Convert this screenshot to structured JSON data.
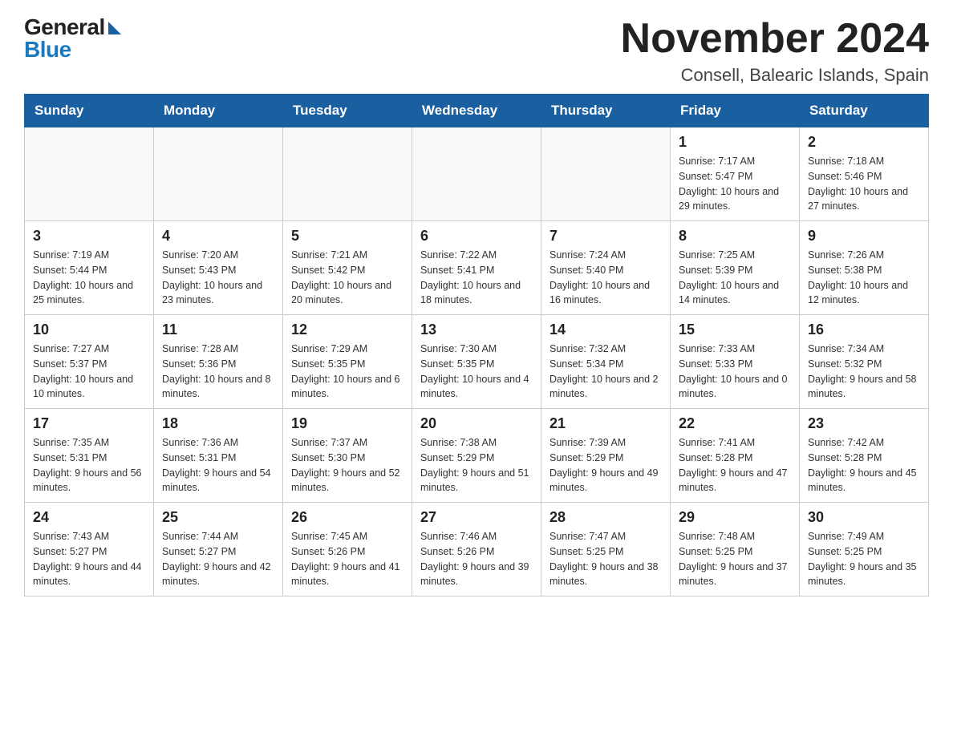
{
  "header": {
    "logo_general": "General",
    "logo_blue": "Blue",
    "title": "November 2024",
    "subtitle": "Consell, Balearic Islands, Spain"
  },
  "days_of_week": [
    "Sunday",
    "Monday",
    "Tuesday",
    "Wednesday",
    "Thursday",
    "Friday",
    "Saturday"
  ],
  "weeks": [
    [
      {
        "day": "",
        "info": ""
      },
      {
        "day": "",
        "info": ""
      },
      {
        "day": "",
        "info": ""
      },
      {
        "day": "",
        "info": ""
      },
      {
        "day": "",
        "info": ""
      },
      {
        "day": "1",
        "info": "Sunrise: 7:17 AM\nSunset: 5:47 PM\nDaylight: 10 hours and 29 minutes."
      },
      {
        "day": "2",
        "info": "Sunrise: 7:18 AM\nSunset: 5:46 PM\nDaylight: 10 hours and 27 minutes."
      }
    ],
    [
      {
        "day": "3",
        "info": "Sunrise: 7:19 AM\nSunset: 5:44 PM\nDaylight: 10 hours and 25 minutes."
      },
      {
        "day": "4",
        "info": "Sunrise: 7:20 AM\nSunset: 5:43 PM\nDaylight: 10 hours and 23 minutes."
      },
      {
        "day": "5",
        "info": "Sunrise: 7:21 AM\nSunset: 5:42 PM\nDaylight: 10 hours and 20 minutes."
      },
      {
        "day": "6",
        "info": "Sunrise: 7:22 AM\nSunset: 5:41 PM\nDaylight: 10 hours and 18 minutes."
      },
      {
        "day": "7",
        "info": "Sunrise: 7:24 AM\nSunset: 5:40 PM\nDaylight: 10 hours and 16 minutes."
      },
      {
        "day": "8",
        "info": "Sunrise: 7:25 AM\nSunset: 5:39 PM\nDaylight: 10 hours and 14 minutes."
      },
      {
        "day": "9",
        "info": "Sunrise: 7:26 AM\nSunset: 5:38 PM\nDaylight: 10 hours and 12 minutes."
      }
    ],
    [
      {
        "day": "10",
        "info": "Sunrise: 7:27 AM\nSunset: 5:37 PM\nDaylight: 10 hours and 10 minutes."
      },
      {
        "day": "11",
        "info": "Sunrise: 7:28 AM\nSunset: 5:36 PM\nDaylight: 10 hours and 8 minutes."
      },
      {
        "day": "12",
        "info": "Sunrise: 7:29 AM\nSunset: 5:35 PM\nDaylight: 10 hours and 6 minutes."
      },
      {
        "day": "13",
        "info": "Sunrise: 7:30 AM\nSunset: 5:35 PM\nDaylight: 10 hours and 4 minutes."
      },
      {
        "day": "14",
        "info": "Sunrise: 7:32 AM\nSunset: 5:34 PM\nDaylight: 10 hours and 2 minutes."
      },
      {
        "day": "15",
        "info": "Sunrise: 7:33 AM\nSunset: 5:33 PM\nDaylight: 10 hours and 0 minutes."
      },
      {
        "day": "16",
        "info": "Sunrise: 7:34 AM\nSunset: 5:32 PM\nDaylight: 9 hours and 58 minutes."
      }
    ],
    [
      {
        "day": "17",
        "info": "Sunrise: 7:35 AM\nSunset: 5:31 PM\nDaylight: 9 hours and 56 minutes."
      },
      {
        "day": "18",
        "info": "Sunrise: 7:36 AM\nSunset: 5:31 PM\nDaylight: 9 hours and 54 minutes."
      },
      {
        "day": "19",
        "info": "Sunrise: 7:37 AM\nSunset: 5:30 PM\nDaylight: 9 hours and 52 minutes."
      },
      {
        "day": "20",
        "info": "Sunrise: 7:38 AM\nSunset: 5:29 PM\nDaylight: 9 hours and 51 minutes."
      },
      {
        "day": "21",
        "info": "Sunrise: 7:39 AM\nSunset: 5:29 PM\nDaylight: 9 hours and 49 minutes."
      },
      {
        "day": "22",
        "info": "Sunrise: 7:41 AM\nSunset: 5:28 PM\nDaylight: 9 hours and 47 minutes."
      },
      {
        "day": "23",
        "info": "Sunrise: 7:42 AM\nSunset: 5:28 PM\nDaylight: 9 hours and 45 minutes."
      }
    ],
    [
      {
        "day": "24",
        "info": "Sunrise: 7:43 AM\nSunset: 5:27 PM\nDaylight: 9 hours and 44 minutes."
      },
      {
        "day": "25",
        "info": "Sunrise: 7:44 AM\nSunset: 5:27 PM\nDaylight: 9 hours and 42 minutes."
      },
      {
        "day": "26",
        "info": "Sunrise: 7:45 AM\nSunset: 5:26 PM\nDaylight: 9 hours and 41 minutes."
      },
      {
        "day": "27",
        "info": "Sunrise: 7:46 AM\nSunset: 5:26 PM\nDaylight: 9 hours and 39 minutes."
      },
      {
        "day": "28",
        "info": "Sunrise: 7:47 AM\nSunset: 5:25 PM\nDaylight: 9 hours and 38 minutes."
      },
      {
        "day": "29",
        "info": "Sunrise: 7:48 AM\nSunset: 5:25 PM\nDaylight: 9 hours and 37 minutes."
      },
      {
        "day": "30",
        "info": "Sunrise: 7:49 AM\nSunset: 5:25 PM\nDaylight: 9 hours and 35 minutes."
      }
    ]
  ]
}
